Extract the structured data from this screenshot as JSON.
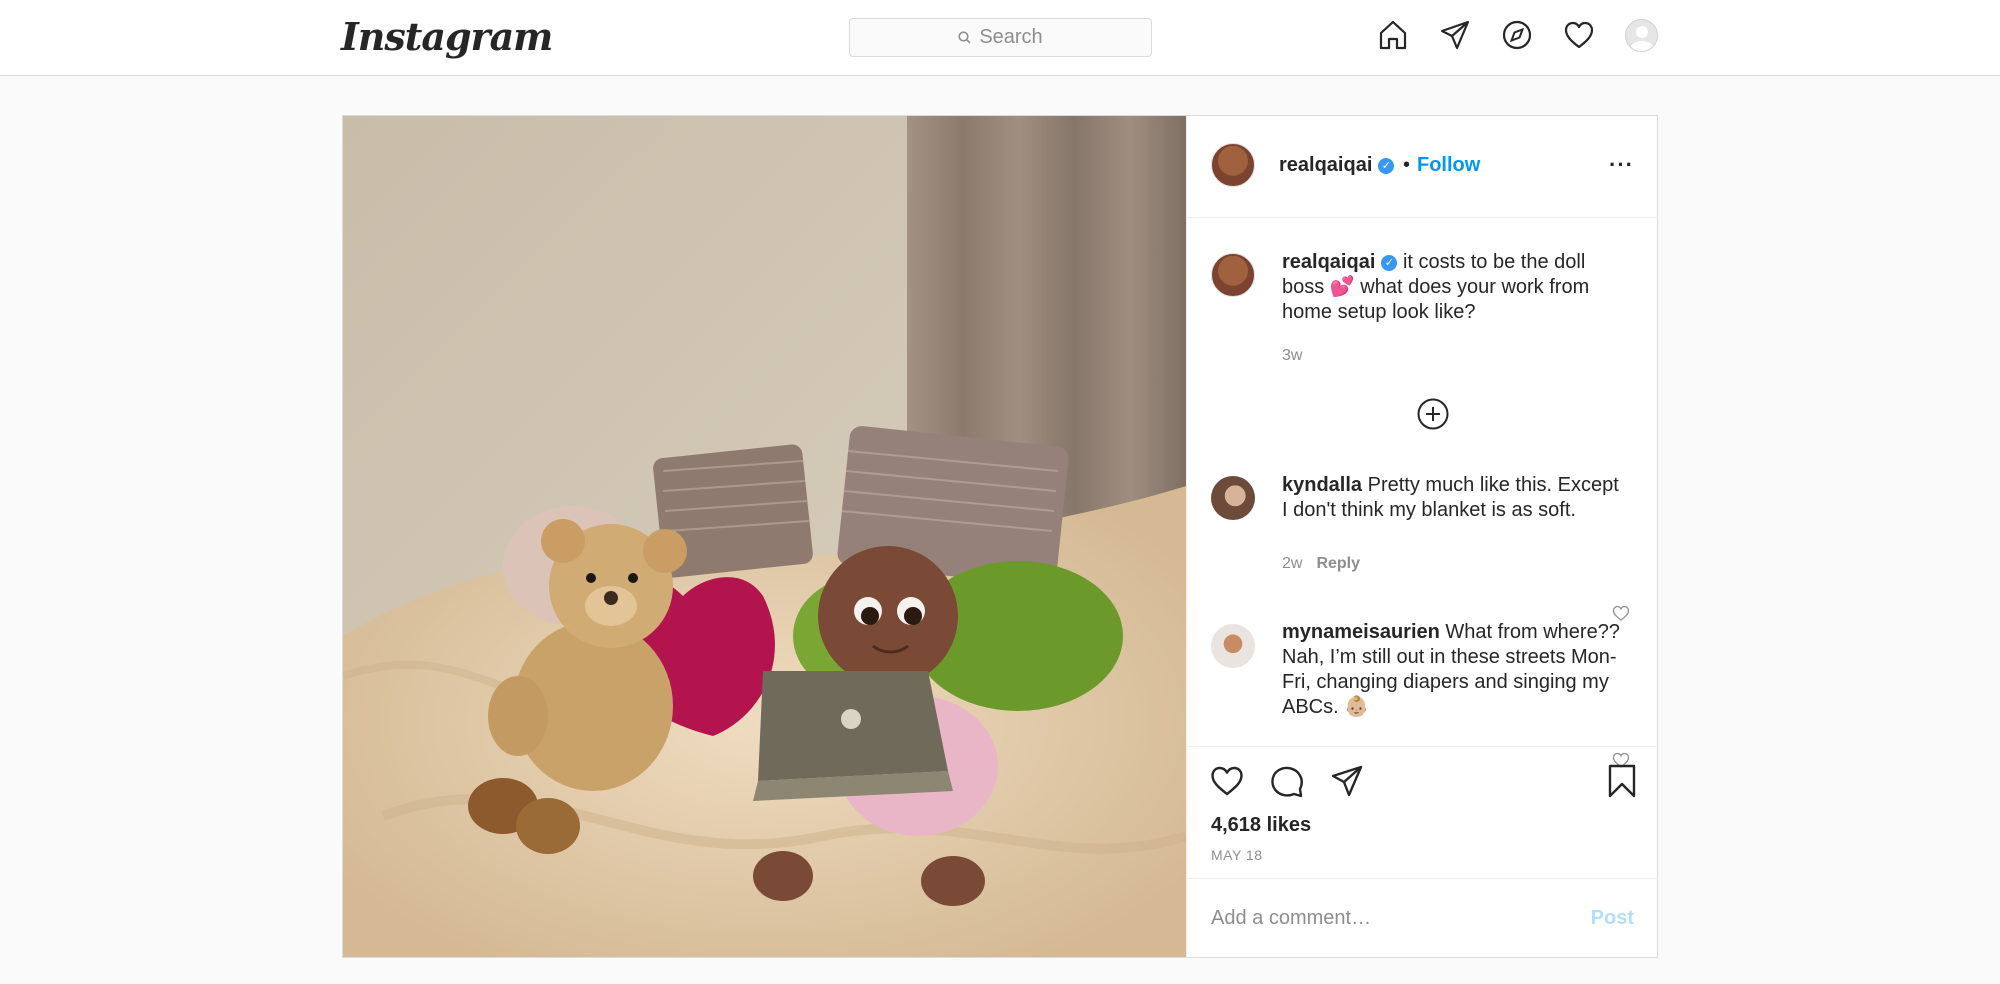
{
  "nav": {
    "logo": "Instagram",
    "search_placeholder": "Search",
    "icons": [
      "home-icon",
      "direct-icon",
      "explore-icon",
      "activity-heart-icon",
      "profile-avatar"
    ]
  },
  "post": {
    "username": "realqaiqai",
    "follow_label": "Follow",
    "separator": "•",
    "more_label": "···",
    "caption": {
      "username": "realqaiqai",
      "text": "it costs to be the doll boss 💕 what does your work from home setup look like?",
      "time": "3w"
    },
    "comments": [
      {
        "username": "kyndalla",
        "text": "Pretty much like this. Except I don't think my blanket is as soft.",
        "time": "2w",
        "reply_label": "Reply"
      },
      {
        "username": "mynameisaurien",
        "text": "What from where?? Nah, I’m still out in these streets Mon-Fri, changing diapers and singing my ABCs. 👶🏼"
      }
    ],
    "likes": "4,618 likes",
    "date": "MAY 18",
    "comment_placeholder": "Add a comment…",
    "post_button": "Post"
  },
  "colors": {
    "accent": "#0095f6",
    "post_disabled": "#b2dffc",
    "verified": "#3897f0"
  }
}
